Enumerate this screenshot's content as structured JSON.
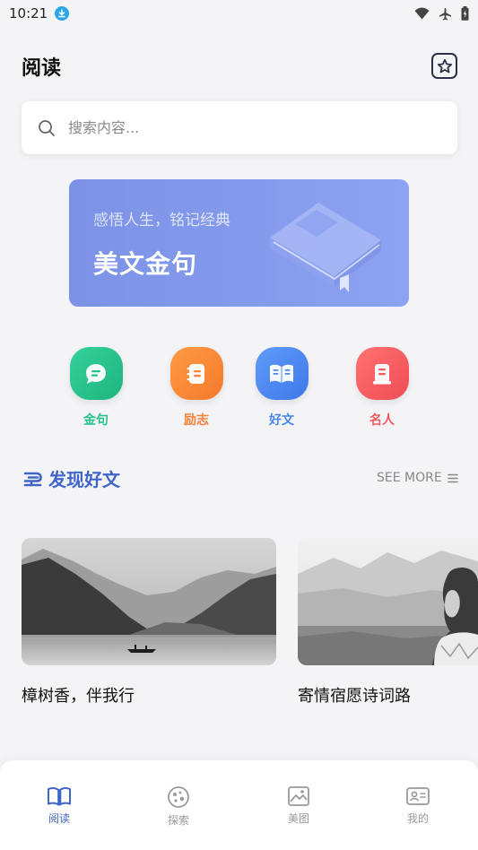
{
  "status_bar": {
    "time": "10:21",
    "icons": [
      "download-icon",
      "wifi-icon",
      "airplane-icon",
      "battery-icon"
    ]
  },
  "header": {
    "title": "阅读",
    "favorite_icon": "star-icon"
  },
  "search": {
    "placeholder": "搜索内容...",
    "value": ""
  },
  "banner": {
    "subtitle": "感悟人生，铭记经典",
    "title": "美文金句",
    "gradient": [
      "#7b92e6",
      "#8ca2f2"
    ]
  },
  "categories": [
    {
      "label": "金句",
      "icon": "chat-bubble-icon",
      "color": "#27c08c"
    },
    {
      "label": "励志",
      "icon": "notebook-icon",
      "color": "#f7823a"
    },
    {
      "label": "好文",
      "icon": "open-book-icon",
      "color": "#4a86ef"
    },
    {
      "label": "名人",
      "icon": "card-icon",
      "color": "#f25a5f"
    }
  ],
  "section": {
    "title": "发现好文",
    "see_more": "SEE MORE",
    "accent": "#4065c9"
  },
  "articles": [
    {
      "title": "樟树香，伴我行"
    },
    {
      "title": "寄情宿愿诗词路"
    }
  ],
  "bottom_nav": {
    "items": [
      {
        "label": "阅读",
        "icon": "book-icon",
        "active": true
      },
      {
        "label": "探索",
        "icon": "explore-icon",
        "active": false
      },
      {
        "label": "美图",
        "icon": "picture-icon",
        "active": false
      },
      {
        "label": "我的",
        "icon": "profile-card-icon",
        "active": false
      }
    ]
  }
}
